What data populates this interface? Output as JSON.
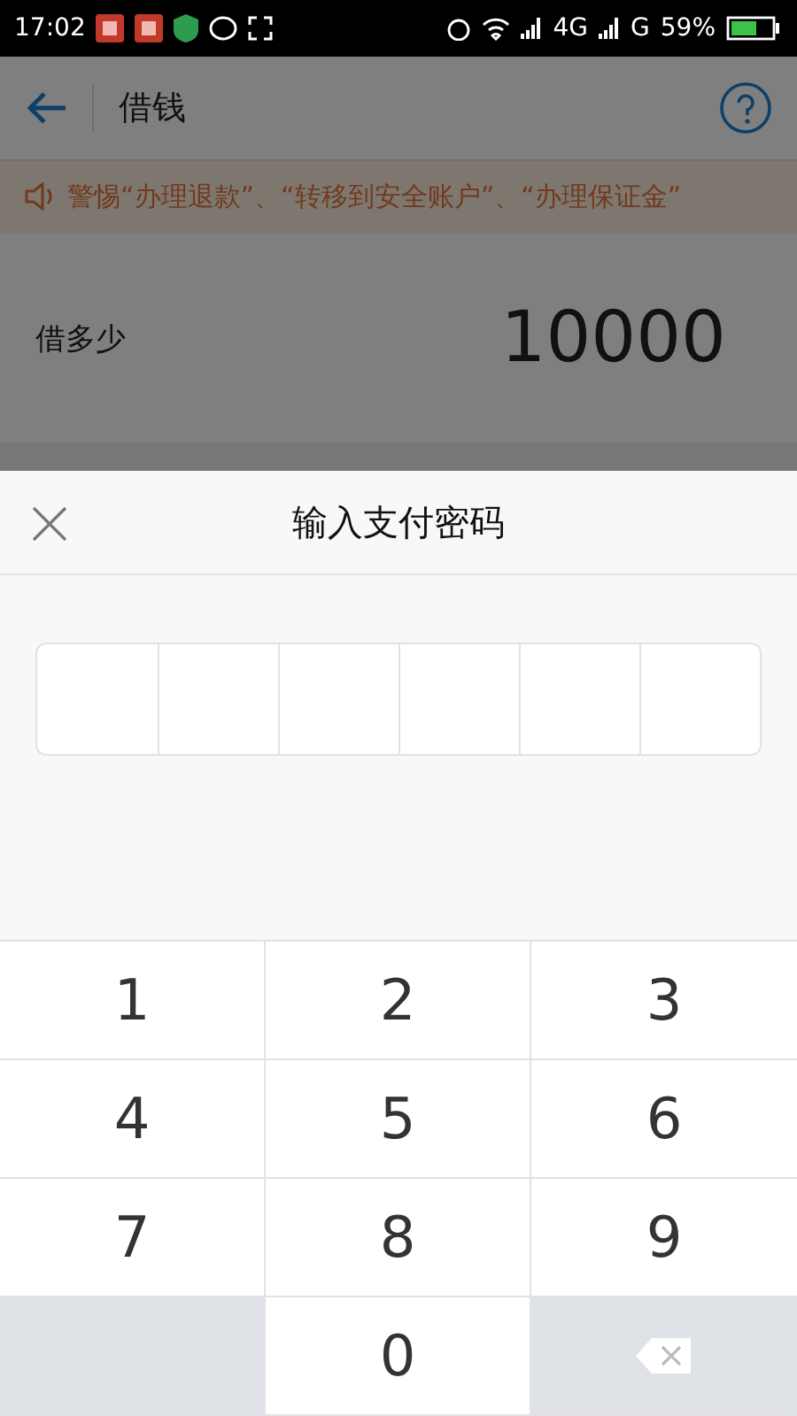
{
  "status_bar": {
    "time": "17:02",
    "network_1": "4G",
    "network_2": "G",
    "battery": "59%"
  },
  "header": {
    "title": "借钱"
  },
  "notice": {
    "text": "警惕“办理退款”、“转移到安全账户”、“办理保证金”"
  },
  "amount": {
    "label": "借多少",
    "value": "10000"
  },
  "dialog": {
    "title": "输入支付密码",
    "pin_slots": [
      {
        "filled": false
      },
      {
        "filled": false
      },
      {
        "filled": false
      },
      {
        "filled": false
      },
      {
        "filled": false
      },
      {
        "filled": false
      }
    ]
  },
  "keypad": [
    {
      "kind": "digit",
      "label": "1"
    },
    {
      "kind": "digit",
      "label": "2"
    },
    {
      "kind": "digit",
      "label": "3"
    },
    {
      "kind": "digit",
      "label": "4"
    },
    {
      "kind": "digit",
      "label": "5"
    },
    {
      "kind": "digit",
      "label": "6"
    },
    {
      "kind": "digit",
      "label": "7"
    },
    {
      "kind": "digit",
      "label": "8"
    },
    {
      "kind": "digit",
      "label": "9"
    },
    {
      "kind": "blank"
    },
    {
      "kind": "digit",
      "label": "0"
    },
    {
      "kind": "backspace"
    }
  ]
}
